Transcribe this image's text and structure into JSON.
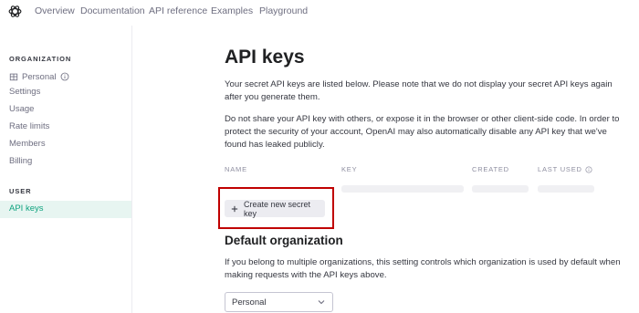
{
  "nav": {
    "links": [
      "Overview",
      "Documentation",
      "API reference",
      "Examples",
      "Playground"
    ]
  },
  "sidebar": {
    "org_section": "ORGANIZATION",
    "org_name": "Personal",
    "org_items": [
      "Settings",
      "Usage",
      "Rate limits",
      "Members",
      "Billing"
    ],
    "user_section": "USER",
    "active_item": "API keys"
  },
  "main": {
    "title": "API keys",
    "para1": "Your secret API keys are listed below. Please note that we do not display your secret API keys again after you generate them.",
    "para2": "Do not share your API key with others, or expose it in the browser or other client-side code. In order to protect the security of your account, OpenAI may also automatically disable any API key that we've found has leaked publicly.",
    "table_headers": {
      "name": "NAME",
      "key": "KEY",
      "created": "CREATED",
      "last_used": "LAST USED"
    },
    "create_button": "Create new secret key",
    "default_org_title": "Default organization",
    "default_org_desc": "If you belong to multiple organizations, this setting controls which organization is used by default when making requests with the API keys above.",
    "org_select_value": "Personal"
  },
  "colors": {
    "accent": "#10a37f",
    "active_bg": "#e7f5f1",
    "highlight": "#c00000"
  }
}
